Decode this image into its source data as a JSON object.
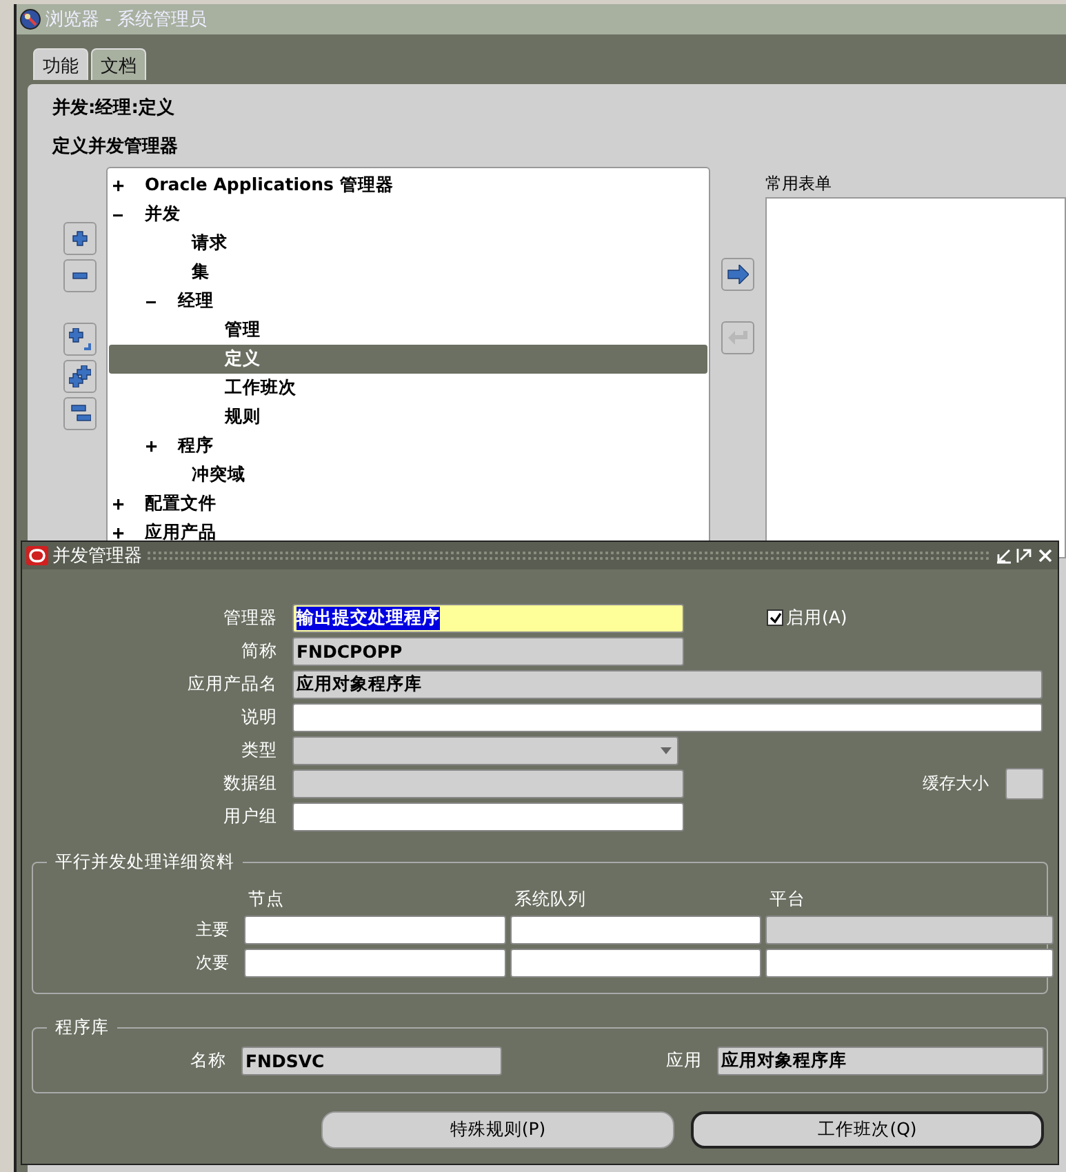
{
  "window": {
    "title": "浏览器 - 系统管理员"
  },
  "tabs": [
    {
      "label": "功能",
      "selected": true
    },
    {
      "label": "文档",
      "selected": false
    }
  ],
  "breadcrumb": "并发:经理:定义",
  "heading": "定义并发管理器",
  "tree": [
    {
      "label": "Oracle Applications 管理器",
      "kind": "folder",
      "expanded": false,
      "selected": false
    },
    {
      "label": "并发",
      "kind": "folder",
      "expanded": true,
      "selected": false,
      "children": [
        {
          "label": "请求",
          "kind": "leaf",
          "selected": false
        },
        {
          "label": "集",
          "kind": "leaf",
          "selected": false
        },
        {
          "label": "经理",
          "kind": "folder",
          "expanded": true,
          "selected": false,
          "children": [
            {
              "label": "管理",
              "kind": "leaf",
              "selected": false
            },
            {
              "label": "定义",
              "kind": "leaf",
              "selected": true
            },
            {
              "label": "工作班次",
              "kind": "leaf",
              "selected": false
            },
            {
              "label": "规则",
              "kind": "leaf",
              "selected": false
            }
          ]
        },
        {
          "label": "程序",
          "kind": "folder",
          "expanded": false,
          "selected": false
        },
        {
          "label": "冲突域",
          "kind": "leaf",
          "selected": false
        }
      ]
    },
    {
      "label": "配置文件",
      "kind": "folder",
      "expanded": false,
      "selected": false
    },
    {
      "label": "应用产品",
      "kind": "folder",
      "expanded": false,
      "selected": false
    }
  ],
  "side_buttons": [
    {
      "kind": "expand",
      "disabled": false
    },
    {
      "kind": "collapse",
      "disabled": false
    },
    {
      "kind": "expand_branch",
      "disabled": false
    },
    {
      "kind": "expand_all",
      "disabled": false
    },
    {
      "kind": "collapse_all",
      "disabled": false
    }
  ],
  "move_buttons": [
    {
      "kind": "add",
      "disabled": false
    },
    {
      "kind": "remove",
      "disabled": true
    }
  ],
  "favorites": {
    "label": "常用表单"
  },
  "dialog": {
    "title": "并发管理器",
    "fields": [
      {
        "label": "管理器",
        "value": "输出提交处理程序",
        "kind": "required",
        "text_selected": true,
        "side": {
          "kind": "checkbox",
          "label": "启用(A)",
          "checked": true
        }
      },
      {
        "label": "简称",
        "value": "FNDCPOPP",
        "kind": "readonly"
      },
      {
        "label": "应用产品名",
        "value": "应用对象程序库",
        "kind": "readonly"
      },
      {
        "label": "说明",
        "kind": "text"
      },
      {
        "label": "类型",
        "kind": "select"
      },
      {
        "label": "数据组",
        "kind": "readonly",
        "side": {
          "kind": "box",
          "label": "缓存大小"
        }
      },
      {
        "label": "用户组",
        "kind": "text"
      }
    ],
    "parallel": {
      "title": "平行并发处理详细资料",
      "columns": [
        "节点",
        "系统队列",
        "平台"
      ],
      "rows": [
        {
          "label": "主要",
          "cells": [
            {
              "kind": "text"
            },
            {
              "kind": "text"
            },
            {
              "kind": "readonly"
            }
          ]
        },
        {
          "label": "次要",
          "cells": [
            {
              "kind": "text"
            },
            {
              "kind": "text"
            },
            {
              "kind": "text"
            }
          ]
        }
      ]
    },
    "library": {
      "title": "程序库",
      "name_label": "名称",
      "name": "FNDSVC",
      "app_label": "应用",
      "app": "应用对象程序库"
    },
    "buttons": [
      {
        "label": "特殊规则(P)",
        "default": false
      },
      {
        "label": "工作班次(Q)",
        "default": true
      }
    ]
  }
}
